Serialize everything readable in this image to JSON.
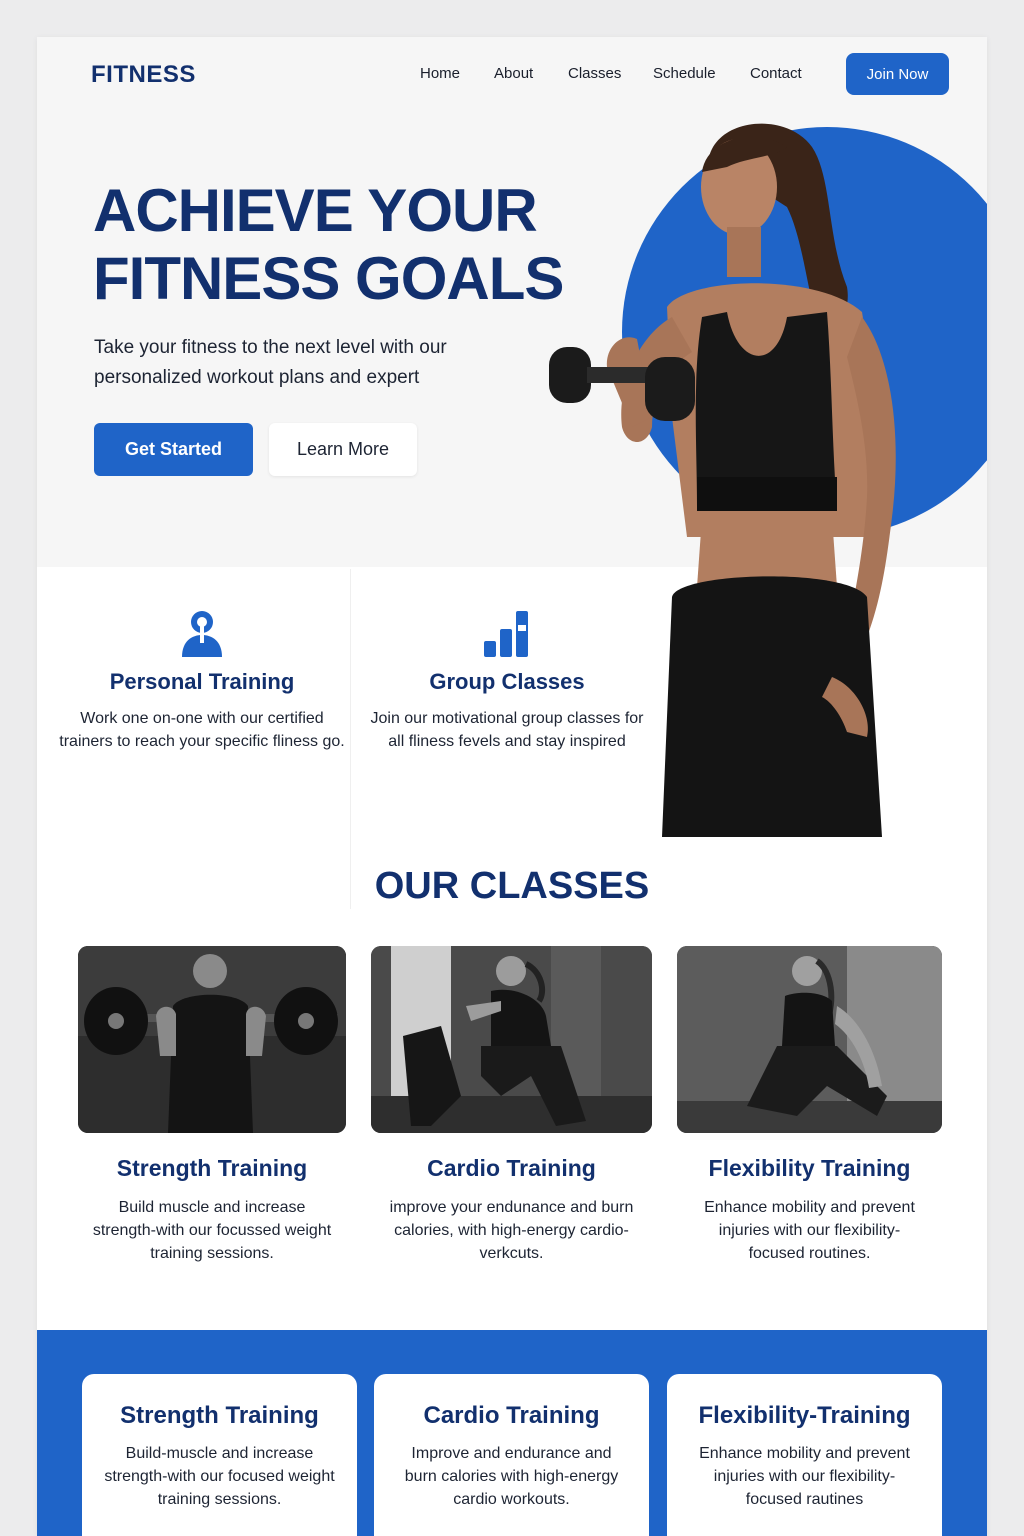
{
  "brand": {
    "logo": "FITNESS",
    "accent": "#1f64c8",
    "navy": "#12306e"
  },
  "nav": {
    "items": [
      "Home",
      "About",
      "Classes",
      "Schedule",
      "Contact"
    ],
    "cta": "Join Now"
  },
  "hero": {
    "title_line1": "ACHIEVE YOUR",
    "title_line2": "FITNESS GOALS",
    "subtitle": "Take your fitness to the next level with our personalized workout plans and expert",
    "primary_button": "Get Started",
    "secondary_button": "Learn More"
  },
  "features": [
    {
      "icon": "person-pin-icon",
      "title": "Personal Training",
      "text": "Work one on-one with our certified trainers to reach your specific fliness go."
    },
    {
      "icon": "bar-chart-icon",
      "title": "Group Classes",
      "text": "Join our motivational group classes for all fliness fevels and stay inspired"
    }
  ],
  "classes": {
    "title": "OUR CLASSES",
    "items": [
      {
        "title": "Strength Training",
        "text": "Build muscle and increase strength-with our focussed weight training sessions."
      },
      {
        "title": "Cardio Training",
        "text": "improve your endunance and burn calories, with high-energy cardio-verkcuts."
      },
      {
        "title": "Flexibility Training",
        "text": "Enhance mobility and prevent injuries with our flexibility-focused routines."
      }
    ]
  },
  "band_cards": [
    {
      "title": "Strength Training",
      "text": "Build-muscle and increase strength-with our focused weight training sessions."
    },
    {
      "title": "Cardio Training",
      "text": "Improve and endurance and burn calories with high-energy cardio workouts."
    },
    {
      "title": "Flexibility-Training",
      "text": "Enhance mobility and prevent injuries with our flexibility-focused rautines"
    }
  ]
}
